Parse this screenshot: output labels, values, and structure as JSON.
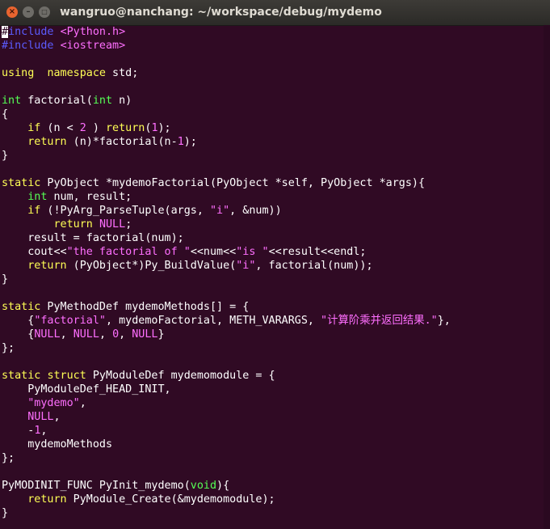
{
  "window": {
    "title": "wangruo@nanchang: ~/workspace/debug/mydemo",
    "buttons": {
      "close": "×",
      "minimize": "–",
      "maximize": "□"
    }
  },
  "colors": {
    "background": "#300a24",
    "default_text": "#ffffff",
    "keyword": "#ffff55",
    "type": "#55ff55",
    "preprocessor": "#5c5cff",
    "string": "#ff6fff",
    "number": "#ff6fff"
  },
  "editor": {
    "lines": [
      [
        [
          "cur",
          "#"
        ],
        [
          "pp",
          "include "
        ],
        [
          "st",
          "<Python.h>"
        ]
      ],
      [
        [
          "pp",
          "#include "
        ],
        [
          "st",
          "<iostream>"
        ]
      ],
      [],
      [
        [
          "kw",
          "using"
        ],
        [
          "",
          "  "
        ],
        [
          "kw",
          "namespace"
        ],
        [
          "",
          " std;"
        ]
      ],
      [],
      [
        [
          "ty",
          "int"
        ],
        [
          "",
          " factorial("
        ],
        [
          "ty",
          "int"
        ],
        [
          "",
          " n)"
        ]
      ],
      [
        [
          "",
          "{"
        ]
      ],
      [
        [
          "",
          "    "
        ],
        [
          "kw",
          "if"
        ],
        [
          "",
          " (n < "
        ],
        [
          "nu",
          "2"
        ],
        [
          "",
          " ) "
        ],
        [
          "kw",
          "return"
        ],
        [
          "",
          "("
        ],
        [
          "nu",
          "1"
        ],
        [
          "",
          ");"
        ]
      ],
      [
        [
          "",
          "    "
        ],
        [
          "kw",
          "return"
        ],
        [
          "",
          " (n)*factorial(n-"
        ],
        [
          "nu",
          "1"
        ],
        [
          "",
          ");"
        ]
      ],
      [
        [
          "",
          "}"
        ]
      ],
      [],
      [
        [
          "kw",
          "static"
        ],
        [
          "",
          " PyObject *mydemoFactorial(PyObject *self, PyObject *args){"
        ]
      ],
      [
        [
          "",
          "    "
        ],
        [
          "ty",
          "int"
        ],
        [
          "",
          " num, result;"
        ]
      ],
      [
        [
          "",
          "    "
        ],
        [
          "kw",
          "if"
        ],
        [
          "",
          " (!PyArg_ParseTuple(args, "
        ],
        [
          "st",
          "\"i\""
        ],
        [
          "",
          ", &num))"
        ]
      ],
      [
        [
          "",
          "        "
        ],
        [
          "kw",
          "return"
        ],
        [
          "",
          " "
        ],
        [
          "nu",
          "NULL"
        ],
        [
          "",
          ";"
        ]
      ],
      [
        [
          "",
          "    result = factorial(num);"
        ]
      ],
      [
        [
          "",
          "    cout<<"
        ],
        [
          "st",
          "\"the factorial of \""
        ],
        [
          "",
          "<<num<<"
        ],
        [
          "st",
          "\"is \""
        ],
        [
          "",
          "<<result<<endl;"
        ]
      ],
      [
        [
          "",
          "    "
        ],
        [
          "kw",
          "return"
        ],
        [
          "",
          " (PyObject*)Py_BuildValue("
        ],
        [
          "st",
          "\"i\""
        ],
        [
          "",
          ", factorial(num));"
        ]
      ],
      [
        [
          "",
          "}"
        ]
      ],
      [],
      [
        [
          "kw",
          "static"
        ],
        [
          "",
          " PyMethodDef mydemoMethods[] = {"
        ]
      ],
      [
        [
          "",
          "    {"
        ],
        [
          "st",
          "\"factorial\""
        ],
        [
          "",
          ", mydemoFactorial, METH_VARARGS, "
        ],
        [
          "st",
          "\"计算阶乘并返回结果.\""
        ],
        [
          "",
          "},"
        ]
      ],
      [
        [
          "",
          "    {"
        ],
        [
          "nu",
          "NULL"
        ],
        [
          "",
          ", "
        ],
        [
          "nu",
          "NULL"
        ],
        [
          "",
          ", "
        ],
        [
          "nu",
          "0"
        ],
        [
          "",
          ", "
        ],
        [
          "nu",
          "NULL"
        ],
        [
          "",
          "}"
        ]
      ],
      [
        [
          "",
          "};"
        ]
      ],
      [],
      [
        [
          "kw",
          "static"
        ],
        [
          "",
          " "
        ],
        [
          "kw",
          "struct"
        ],
        [
          "",
          " PyModuleDef mydemomodule = {"
        ]
      ],
      [
        [
          "",
          "    PyModuleDef_HEAD_INIT,"
        ]
      ],
      [
        [
          "",
          "    "
        ],
        [
          "st",
          "\"mydemo\""
        ],
        [
          "",
          ","
        ]
      ],
      [
        [
          "",
          "    "
        ],
        [
          "nu",
          "NULL"
        ],
        [
          "",
          ","
        ]
      ],
      [
        [
          "",
          "    -"
        ],
        [
          "nu",
          "1"
        ],
        [
          "",
          ","
        ]
      ],
      [
        [
          "",
          "    mydemoMethods"
        ]
      ],
      [
        [
          "",
          "};"
        ]
      ],
      [],
      [
        [
          "",
          "PyMODINIT_FUNC PyInit_mydemo("
        ],
        [
          "ty",
          "void"
        ],
        [
          "",
          "){"
        ]
      ],
      [
        [
          "",
          "    "
        ],
        [
          "kw",
          "return"
        ],
        [
          "",
          " PyModule_Create(&mydemomodule);"
        ]
      ],
      [
        [
          "",
          "}"
        ]
      ]
    ]
  }
}
